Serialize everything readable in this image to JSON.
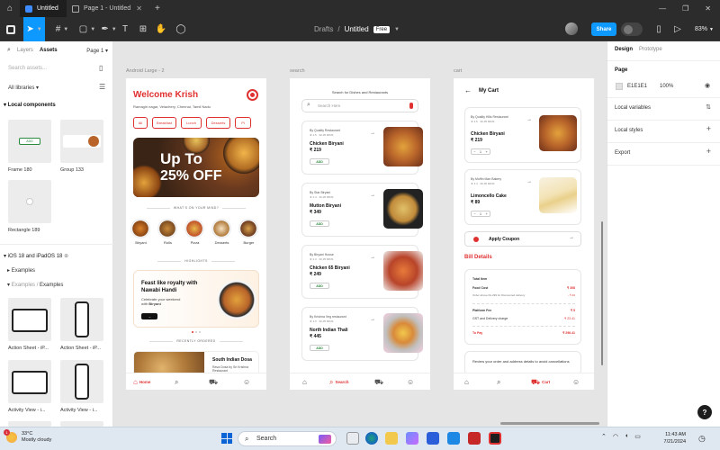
{
  "window": {
    "tabs": [
      {
        "label": "Untitled"
      },
      {
        "label": "Page 1 - Untitled"
      }
    ]
  },
  "toolbar": {
    "breadcrumb_project": "Drafts",
    "breadcrumb_sep": "/",
    "file_name": "Untitled",
    "plan_badge": "Free",
    "share_label": "Share",
    "zoom": "83%"
  },
  "left_panel": {
    "tabs": {
      "layers": "Layers",
      "assets": "Assets",
      "page": "Page 1"
    },
    "search_placeholder": "Search assets...",
    "libraries_filter": "All libraries",
    "local_components_heading": "Local components",
    "components": [
      {
        "label": "Frame 180",
        "inner_text": "ADD"
      },
      {
        "label": "Group 133"
      },
      {
        "label": "Rectangle 189"
      }
    ],
    "library_heading": "iOS 18 and iPadOS 18",
    "examples_group": "Examples",
    "examples_path_dim": "Examples /",
    "examples_path": "Examples",
    "example_items": [
      {
        "label": "Action Sheet - iP..."
      },
      {
        "label": "Action Sheet - iP..."
      },
      {
        "label": "Activity View - i..."
      },
      {
        "label": "Activity View - i..."
      }
    ]
  },
  "canvas": {
    "frames": [
      {
        "label": "Android Large - 2"
      },
      {
        "label": "search"
      },
      {
        "label": "cart"
      }
    ]
  },
  "home": {
    "title": "Welcome Krish",
    "address": "Ramagiri nagar, Velachery, Chennai, Tamil Nadu",
    "categories": [
      "All",
      "Breakfast",
      "Lunch",
      "Desserts",
      "Pi"
    ],
    "banner_line1": "Up To",
    "banner_line2": "25% OFF",
    "section_mind": "WHAT'S ON YOUR MIND?",
    "mind_items": [
      "Biryani",
      "Rolls",
      "Pizza",
      "Desserts",
      "Burger"
    ],
    "section_highlights": "HIGHLIGHTS",
    "promo_title": "Feast like royalty with Nawabi Handi",
    "promo_sub_1": "Celebrate your weekend",
    "promo_sub_2": "with",
    "promo_sub_bold": "Biryani",
    "section_recent": "RECENTLY ORDERED",
    "recent_name": "South Indian Dosa",
    "recent_desc": "Rava Dosa by Sri Krishna Restaurant",
    "nav_home": "Home"
  },
  "search": {
    "title": "Search for Dishes and Restaurants",
    "placeholder": "Search Here",
    "results": [
      {
        "restaurant": "By Quality Restaurant",
        "meta": "★ 4.5 · 30-35 MINS",
        "name": "Chicken Biryani",
        "price": "₹ 219",
        "add": "ADD"
      },
      {
        "restaurant": "By Star Biryani",
        "meta": "★ 4.4 · 30-35 MINS",
        "name": "Mutton Biryani",
        "price": "₹ 349",
        "add": "ADD"
      },
      {
        "restaurant": "By Biryani House",
        "meta": "★ 4.3 · 30-35 MINS",
        "name": "Chicken 65 Biryani",
        "price": "₹ 249",
        "add": "ADD"
      },
      {
        "restaurant": "By Krishna Veg restaurant",
        "meta": "★ 4.5 · 30-35 MINS",
        "name": "North Indian Thali",
        "price": "₹ 445",
        "add": "ADD"
      }
    ],
    "nav_search": "Search"
  },
  "cart": {
    "title": "My Cart",
    "items": [
      {
        "restaurant": "By Quality Hills Restaurant",
        "meta": "★ 4.5 · 30-35 MINS",
        "name": "Chicken Biryani",
        "price": "₹ 219",
        "qty": "1"
      },
      {
        "restaurant": "By Muffin Man Bakery",
        "meta": "★ 4.4 · 30-35 MINS",
        "name": "Limoncello Cake",
        "price": "₹ 89",
        "qty": "1"
      }
    ],
    "coupon_label": "Apply Coupon",
    "bill_title": "Bill Details",
    "bill_rows": {
      "total_item": "Total Item",
      "food_cost": "Food Cost",
      "food_cost_value": "₹ 308",
      "discount": "Order above Rs.299 for Discounted delivery",
      "discount_value": "- ₹ 40",
      "platform_fee": "Platform Fee",
      "platform_fee_value": "₹ 5",
      "gst": "GST and Delivery charge",
      "gst_value": "₹ 23.41",
      "to_pay": "To Pay",
      "to_pay_value": "₹ 296.41"
    },
    "review_text": "Review your order and address details to avoid cancellations",
    "nav_cart": "Cart"
  },
  "right_panel": {
    "tabs": {
      "design": "Design",
      "prototype": "Prototype"
    },
    "page_heading": "Page",
    "page_color": "E1E1E1",
    "page_opacity": "100%",
    "local_variables": "Local variables",
    "local_styles": "Local styles",
    "export": "Export",
    "help": "?"
  },
  "taskbar": {
    "notification_count": "1",
    "temperature": "33°C",
    "weather": "Mostly cloudy",
    "search_label": "Search",
    "time": "11:43 AM",
    "date": "7/21/2024"
  },
  "colors": {
    "accent": "#0d99ff",
    "brand_red": "#e03131",
    "canvas_bg": "#e5e5e5"
  }
}
